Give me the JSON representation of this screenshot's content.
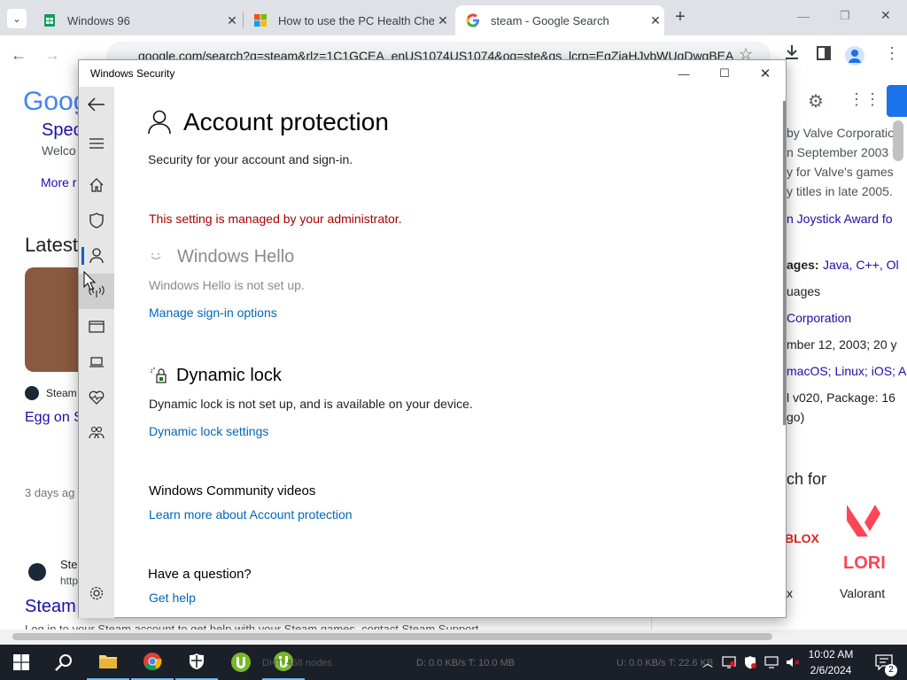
{
  "browser": {
    "tabs": [
      {
        "title": "Windows 96",
        "close": "✕"
      },
      {
        "title": "How to use the PC Health Chec",
        "close": "✕"
      },
      {
        "title": "steam - Google Search",
        "close": "✕"
      }
    ],
    "new_tab": "+",
    "url": "google.com/search?q=steam&rlz=1C1GCEA_enUS1074US1074&oq=ste&gs_lcrp=EgZjaHJvbWUqDwgBEA"
  },
  "google_page": {
    "logo": "Goog",
    "left_items": [
      "Spec",
      "Welco",
      "More r",
      "Latest",
      "Steam",
      "Egg on S",
      "3 days ag",
      "Ste",
      "http",
      "Steam"
    ],
    "bottom_snippet": "Log in to your Steam account to get help with your Steam games, contact Steam Support",
    "right_items": [
      "by Valve Corporatio",
      "n September 2003 t",
      "y for Valve's games",
      "y titles in late 2005.",
      "n Joystick Award fo",
      "ages:",
      "Java, C++, Ol",
      "uages",
      "Corporation",
      "mber 12, 2003; 20 y",
      "macOS; Linux; iOS; A",
      "l v020, Package: 16",
      "go)",
      "ch for",
      "x",
      "Valorant"
    ]
  },
  "window": {
    "title": "Windows Security",
    "controls": {
      "minimize": "—",
      "maximize": "☐",
      "close": "✕"
    }
  },
  "content": {
    "title": "Account protection",
    "subtitle": "Security for your account and sign-in.",
    "admin_warning": "This setting is managed by your administrator.",
    "hello_title": "Windows Hello",
    "hello_status": "Windows Hello is not set up.",
    "hello_link": "Manage sign-in options",
    "dynamic_title": "Dynamic lock",
    "dynamic_status": "Dynamic lock is not set up, and is available on your device.",
    "dynamic_link": "Dynamic lock settings",
    "community_title": "Windows Community videos",
    "community_link": "Learn more about Account protection",
    "question_title": "Have a question?",
    "help_link": "Get help"
  },
  "sidebar": {
    "items": [
      "back-icon",
      "menu-icon",
      "home-icon",
      "shield-icon",
      "person-icon",
      "network-icon",
      "app-browser-icon",
      "device-icon",
      "health-icon",
      "family-icon",
      "settings-icon"
    ]
  },
  "taskbar": {
    "utorrent_text": "DHT: 468 nodes",
    "down_text": "D: 0.0 KB/s T: 10.0 MB",
    "up_text": "U: 0.0 KB/s T: 22.6 KB",
    "time": "10:02 AM",
    "date": "2/6/2024",
    "notifications": "2"
  },
  "colors": {
    "accent": "#0067b8",
    "warning": "#a80000",
    "selected_bar": "#0067c0"
  }
}
